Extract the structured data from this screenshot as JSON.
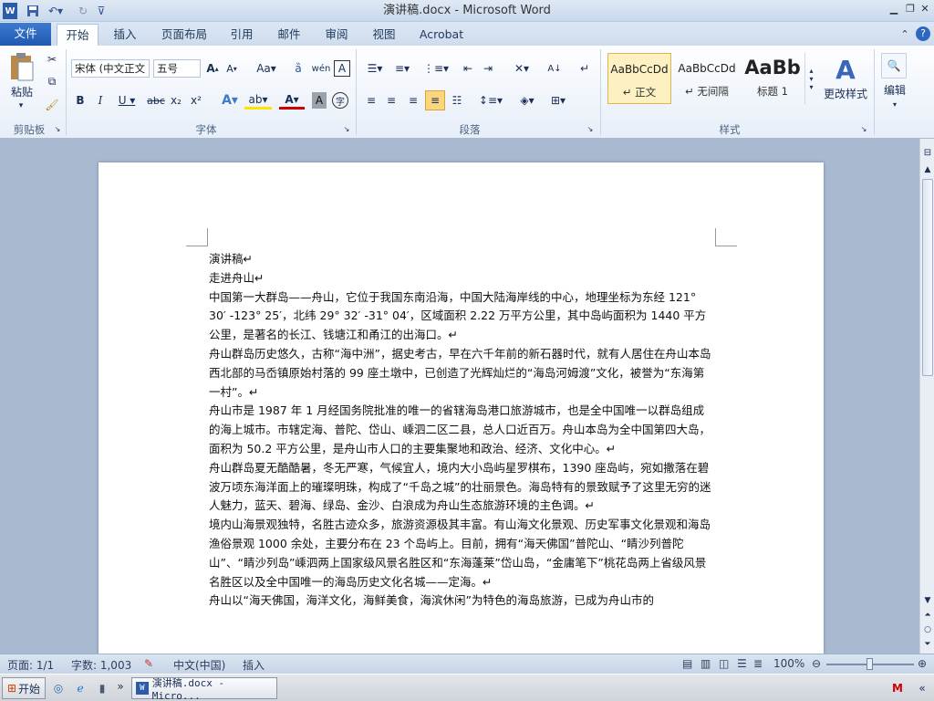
{
  "window": {
    "title": "演讲稿.docx - Microsoft Word"
  },
  "tabs": [
    "文件",
    "开始",
    "插入",
    "页面布局",
    "引用",
    "邮件",
    "审阅",
    "视图",
    "Acrobat"
  ],
  "ribbon": {
    "clipboard": {
      "paste_label": "粘贴",
      "group_label": "剪贴板"
    },
    "font": {
      "font_name": "宋体 (中文正文",
      "font_size": "五号",
      "group_label": "字体"
    },
    "paragraph": {
      "group_label": "段落"
    },
    "styles": {
      "items": [
        {
          "preview": "AaBbCcDd",
          "name": "↵ 正文"
        },
        {
          "preview": "AaBbCcDd",
          "name": "↵ 无间隔"
        },
        {
          "preview": "AaBb",
          "name": "标题 1"
        }
      ],
      "change_styles": "更改样式",
      "group_label": "样式"
    },
    "editing": {
      "label": "编辑"
    }
  },
  "document": {
    "paragraphs": [
      "演讲稿↵",
      "走进舟山↵",
      "中国第一大群岛——舟山，它位于我国东南沿海，中国大陆海岸线的中心，地理坐标为东经 121° 30′ -123° 25′，北纬 29° 32′ -31° 04′，区域面积 2.22 万平方公里，其中岛屿面积为 1440 平方公里，是著名的长江、钱塘江和甬江的出海口。↵",
      "舟山群岛历史悠久，古称“海中洲”，据史考古，早在六千年前的新石器时代，就有人居住在舟山本岛西北部的马岙镇原始村落的 99 座土墩中，已创造了光辉灿烂的“海岛河姆渡”文化，被誉为“东海第一村”。↵",
      "舟山市是 1987 年 1 月经国务院批准的唯一的省辖海岛港口旅游城市，也是全中国唯一以群岛组成的海上城市。市辖定海、普陀、岱山、嵊泗二区二县，总人口近百万。舟山本岛为全中国第四大岛，面积为 50.2 平方公里，是舟山市人口的主要集聚地和政治、经济、文化中心。↵",
      "舟山群岛夏无酷酷暑，冬无严寒，气候宜人，境内大小岛屿星罗棋布，1390 座岛屿，宛如撒落在碧波万顷东海洋面上的璀璨明珠，构成了“千岛之城”的壮丽景色。海岛特有的景致赋予了这里无穷的迷人魅力，蓝天、碧海、绿岛、金沙、白浪成为舟山生态旅游环境的主色调。↵",
      "境内山海景观独特，名胜古迹众多，旅游资源极其丰富。有山海文化景观、历史军事文化景观和海岛渔俗景观 1000 余处，主要分布在 23 个岛屿上。目前，拥有“海天佛国”普陀山、“睛沙列普陀山”、“睛沙列岛”嵊泗两上国家级风景名胜区和“东海蓬莱”岱山岛，“金庸笔下”桃花岛两上省级风景名胜区以及全中国唯一的海岛历史文化名城——定海。↵",
      "舟山以“海天佛国，海洋文化，海鲜美食，海滨休闲”为特色的海岛旅游，已成为舟山市的"
    ]
  },
  "status": {
    "page": "页面: 1/1",
    "words": "字数: 1,003",
    "language": "中文(中国)",
    "mode": "插入",
    "zoom": "100%"
  },
  "taskbar": {
    "start": "开始",
    "task": "演讲稿.docx - Micro..."
  }
}
